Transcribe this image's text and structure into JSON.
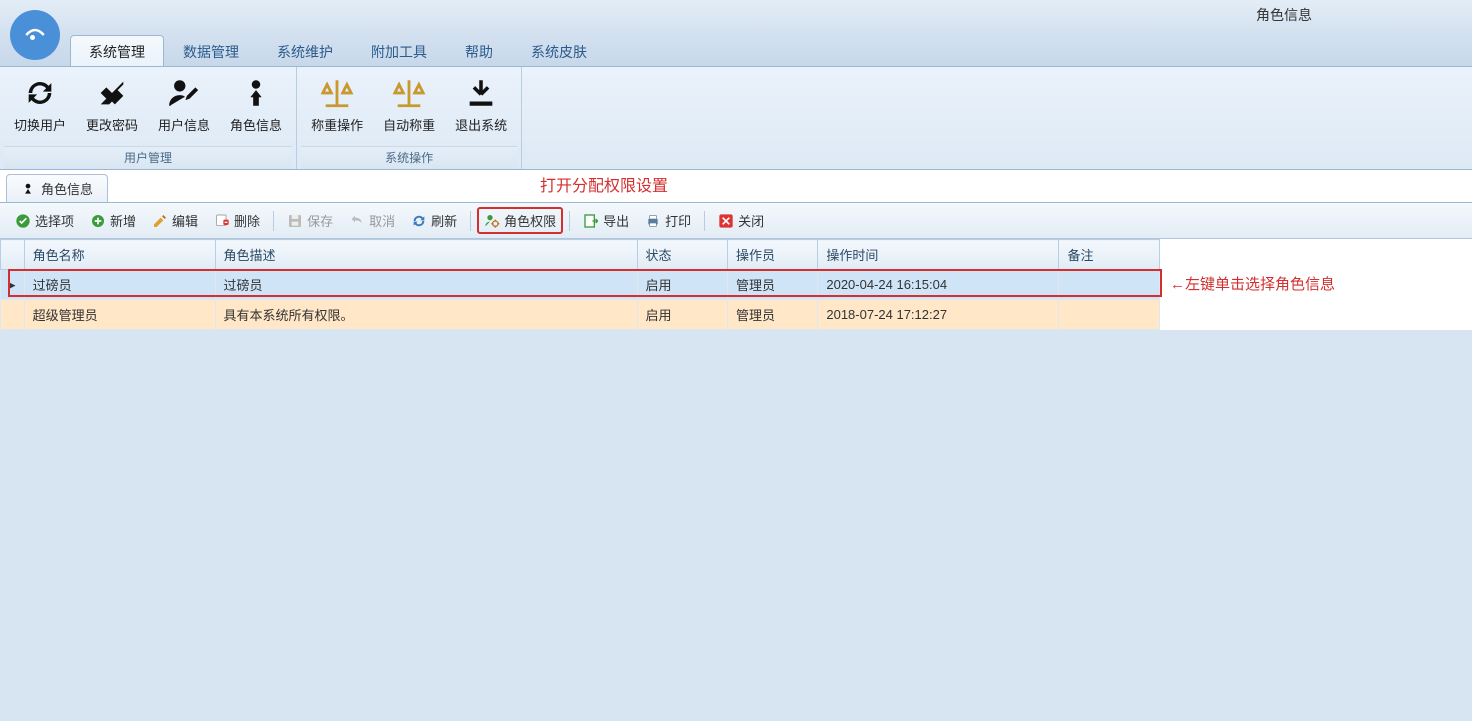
{
  "title": "角色信息",
  "tabs": {
    "system_manage": "系统管理",
    "data_manage": "数据管理",
    "system_maintain": "系统维护",
    "extra_tools": "附加工具",
    "help": "帮助",
    "system_skin": "系统皮肤"
  },
  "ribbon": {
    "group_user_manage": "用户管理",
    "group_system_op": "系统操作",
    "switch_user": "切换用户",
    "change_password": "更改密码",
    "user_info": "用户信息",
    "role_info": "角色信息",
    "weigh_op": "称重操作",
    "auto_weigh": "自动称重",
    "exit_system": "退出系统"
  },
  "doc_tab": {
    "label": "角色信息"
  },
  "annotations": {
    "open_perm": "打开分配权限设置",
    "left_click": "←左键单击选择角色信息"
  },
  "toolbar": {
    "select": "选择项",
    "add": "新增",
    "edit": "编辑",
    "delete": "删除",
    "save": "保存",
    "cancel": "取消",
    "refresh": "刷新",
    "role_perm": "角色权限",
    "export": "导出",
    "print": "打印",
    "close": "关闭"
  },
  "columns": {
    "name": "角色名称",
    "desc": "角色描述",
    "status": "状态",
    "operator": "操作员",
    "op_time": "操作时间",
    "note": "备注"
  },
  "rows": [
    {
      "name": "过磅员",
      "desc": "过磅员",
      "status": "启用",
      "operator": "管理员",
      "op_time": "2020-04-24 16:15:04",
      "note": ""
    },
    {
      "name": "超级管理员",
      "desc": "具有本系统所有权限。",
      "status": "启用",
      "operator": "管理员",
      "op_time": "2018-07-24 17:12:27",
      "note": ""
    }
  ]
}
